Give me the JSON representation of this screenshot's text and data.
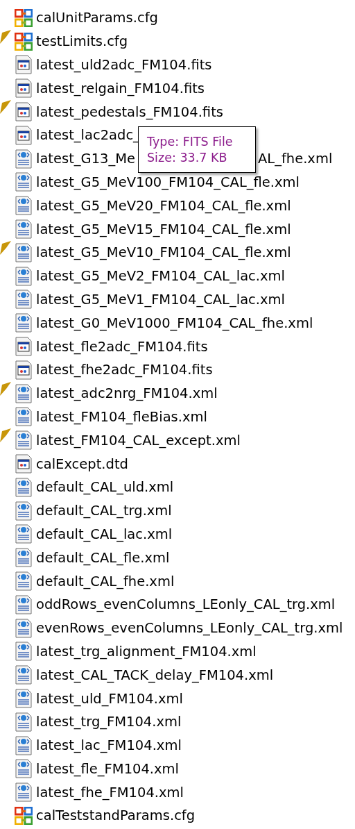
{
  "files": [
    {
      "kind": "cfg",
      "name": "calUnitParams.cfg",
      "marked": false
    },
    {
      "kind": "cfg",
      "name": "testLimits.cfg",
      "marked": true
    },
    {
      "kind": "fits",
      "name": "latest_uld2adc_FM104.fits",
      "marked": false
    },
    {
      "kind": "fits",
      "name": "latest_relgain_FM104.fits",
      "marked": false
    },
    {
      "kind": "fits",
      "name": "latest_pedestals_FM104.fits",
      "marked": true
    },
    {
      "kind": "fits",
      "name": "latest_lac2adc_",
      "marked": false
    },
    {
      "kind": "xml",
      "name": "latest_G13_Me",
      "tail": "AL_fhe.xml",
      "marked": false
    },
    {
      "kind": "xml",
      "name": "latest_G5_MeV100_FM104_CAL_fle.xml",
      "marked": false
    },
    {
      "kind": "xml",
      "name": "latest_G5_MeV20_FM104_CAL_fle.xml",
      "marked": false
    },
    {
      "kind": "xml",
      "name": "latest_G5_MeV15_FM104_CAL_fle.xml",
      "marked": false
    },
    {
      "kind": "xml",
      "name": "latest_G5_MeV10_FM104_CAL_fle.xml",
      "marked": true
    },
    {
      "kind": "xml",
      "name": "latest_G5_MeV2_FM104_CAL_lac.xml",
      "marked": false
    },
    {
      "kind": "xml",
      "name": "latest_G5_MeV1_FM104_CAL_lac.xml",
      "marked": false
    },
    {
      "kind": "xml",
      "name": "latest_G0_MeV1000_FM104_CAL_fhe.xml",
      "marked": false
    },
    {
      "kind": "fits",
      "name": "latest_fle2adc_FM104.fits",
      "marked": false
    },
    {
      "kind": "fits",
      "name": "latest_fhe2adc_FM104.fits",
      "marked": false
    },
    {
      "kind": "xml",
      "name": "latest_adc2nrg_FM104.xml",
      "marked": true
    },
    {
      "kind": "xml",
      "name": "latest_FM104_fleBias.xml",
      "marked": false
    },
    {
      "kind": "xml",
      "name": "latest_FM104_CAL_except.xml",
      "marked": true
    },
    {
      "kind": "fits",
      "name": "calExcept.dtd",
      "marked": false
    },
    {
      "kind": "xml",
      "name": "default_CAL_uld.xml",
      "marked": false
    },
    {
      "kind": "xml",
      "name": "default_CAL_trg.xml",
      "marked": false
    },
    {
      "kind": "xml",
      "name": "default_CAL_lac.xml",
      "marked": false
    },
    {
      "kind": "xml",
      "name": "default_CAL_fle.xml",
      "marked": false
    },
    {
      "kind": "xml",
      "name": "default_CAL_fhe.xml",
      "marked": false
    },
    {
      "kind": "xml",
      "name": "oddRows_evenColumns_LEonly_CAL_trg.xml",
      "marked": false
    },
    {
      "kind": "xml",
      "name": "evenRows_evenColumns_LEonly_CAL_trg.xml",
      "marked": false
    },
    {
      "kind": "xml",
      "name": "latest_trg_alignment_FM104.xml",
      "marked": false
    },
    {
      "kind": "xml",
      "name": "latest_CAL_TACK_delay_FM104.xml",
      "marked": false
    },
    {
      "kind": "xml",
      "name": "latest_uld_FM104.xml",
      "marked": false
    },
    {
      "kind": "xml",
      "name": "latest_trg_FM104.xml",
      "marked": false
    },
    {
      "kind": "xml",
      "name": "latest_lac_FM104.xml",
      "marked": false
    },
    {
      "kind": "xml",
      "name": "latest_fle_FM104.xml",
      "marked": false
    },
    {
      "kind": "xml",
      "name": "latest_fhe_FM104.xml",
      "marked": false
    },
    {
      "kind": "cfg",
      "name": "calTeststandParams.cfg",
      "marked": false
    }
  ],
  "tooltip": {
    "lines": [
      "Type: FITS File",
      "Size: 33.7 KB"
    ]
  }
}
